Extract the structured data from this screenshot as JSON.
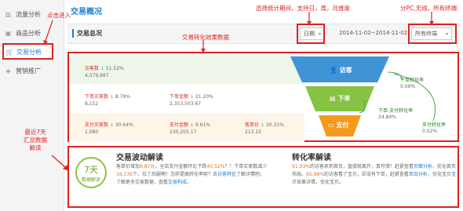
{
  "sidebar": {
    "items": [
      {
        "label": "流量分析",
        "icon": "chart-icon"
      },
      {
        "label": "商品分析",
        "icon": "box-icon"
      },
      {
        "label": "交易分析",
        "icon": "cart-icon"
      },
      {
        "label": "营销推广",
        "icon": "megaphone-icon"
      }
    ]
  },
  "header": {
    "title": "交易概况",
    "section_title": "交易总况",
    "period_select": "日期",
    "date_range": "2014-11-02~2014-11-02",
    "terminal_select": "所有终端"
  },
  "annotations": {
    "click_in": "点击进入",
    "period": "选择统计期间，支持日，周，月维度",
    "terminal": "分PC,无线，所有终端",
    "conversion": "交易转化效果数据",
    "summary_line1": "最近7天",
    "summary_line2": "汇总数据",
    "summary_line3": "解读"
  },
  "conversion": {
    "row1": {
      "metrics": [
        {
          "label": "访客数",
          "trend": "↓",
          "pct": "11.52%",
          "value": "4,579,697"
        }
      ]
    },
    "row2": {
      "metrics": [
        {
          "label": "下单买家数",
          "trend": "↓",
          "pct": "8.79%",
          "value": "8,152"
        },
        {
          "label": "下单金额",
          "trend": "↓",
          "pct": "21.20%",
          "value": "2,353,503.67"
        }
      ]
    },
    "row3": {
      "metrics": [
        {
          "label": "支付买家数",
          "trend": "↓",
          "pct": "30.64%",
          "value": "1,080"
        },
        {
          "label": "支付金额",
          "trend": "↓",
          "pct": "9.61%",
          "value": "230,205.17"
        },
        {
          "label": "客单价",
          "trend": "↓",
          "pct": "30.31%",
          "value": "213.15"
        }
      ]
    },
    "funnel": {
      "stage1": "访客",
      "stage2": "下单",
      "stage3": "支付",
      "rate1_label": "下单转化率",
      "rate1_value": "0.09%",
      "rate2_label": "下单-支付转化率",
      "rate2_value": "24.84%",
      "rate3_label": "支付转化率",
      "rate3_value": "0.02%"
    },
    "colors": {
      "stage1": "#3f94d8",
      "stage2": "#86c343",
      "stage3": "#f39a1e"
    }
  },
  "summary": {
    "badge_number": "7天",
    "badge_text": "数据解读",
    "wave_title": "交易波动解读",
    "wave_text_1": "客单价增加",
    "wave_hl_1": "6.87元",
    "wave_text_2": "，全店支付金额环比下跌",
    "wave_hl_2": "40.52%",
    "wave_text_3": "？！下单买家数减少",
    "wave_hl_3": "16,135",
    "wave_text_4": "个，拉了后腿啊！怎样提高转化率呢？",
    "wave_text_5": "去",
    "wave_link_1": "访客特征",
    "wave_text_6": "了解详情吧。",
    "wave_text_7": "了解更多交易数据，查看",
    "wave_link_2": "交易构成",
    "wave_text_8": "。",
    "rate_title": "转化率解读",
    "rate_hl_1": "91.03%",
    "rate_text_1": "的访客来到首页，直接就离开，真可惜！赶紧查看",
    "rate_link_1": "页面分析",
    "rate_text_2": "，优化首页布局。",
    "rate_hl_2": "65.98%",
    "rate_text_3": "的访客看了宝贝，却没有下单，赶紧查看",
    "rate_link_2": "单品分析",
    "rate_text_4": "，优化宝贝",
    "rate_link_3": "宝贝",
    "rate_text_5": "效果详情，优化宝贝。"
  }
}
